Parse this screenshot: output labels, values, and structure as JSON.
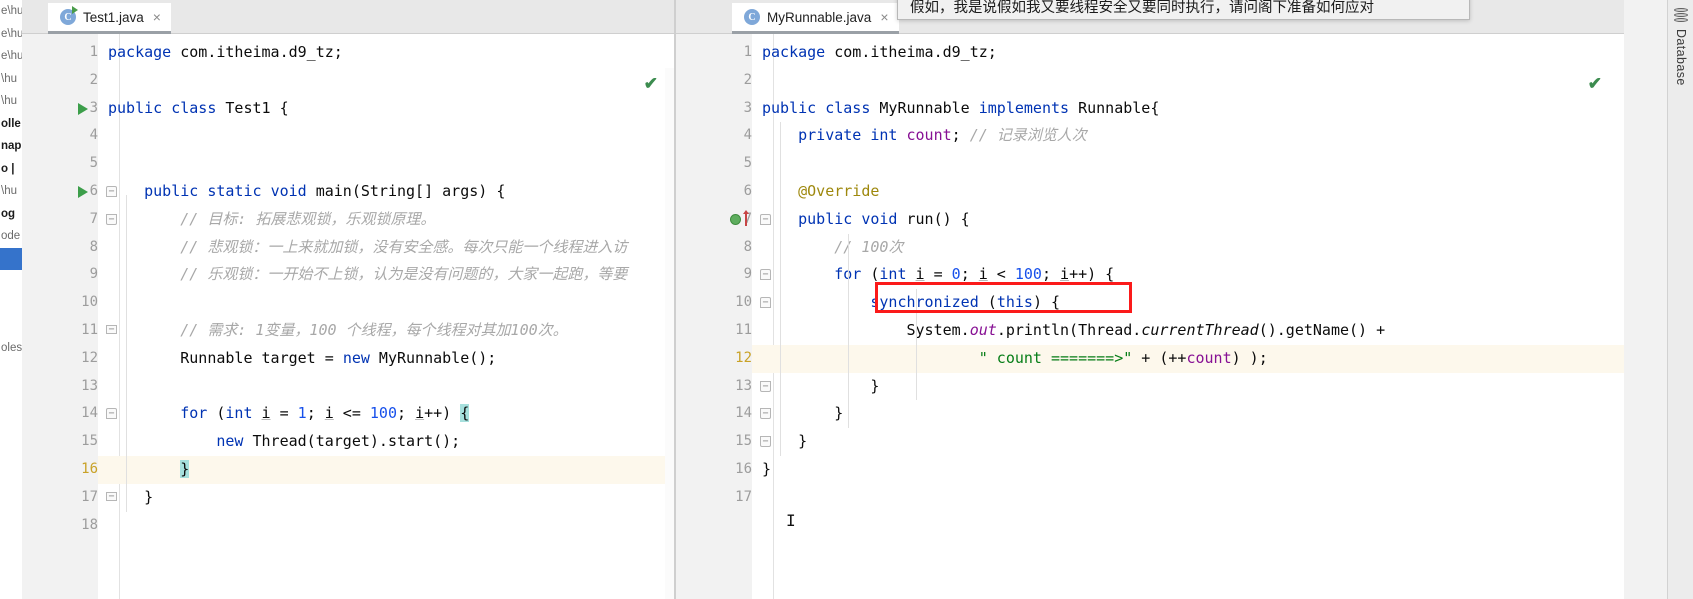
{
  "window": {
    "right_tool_tab": "Database",
    "right_tool_icon": "database-icon"
  },
  "popup": {
    "text": "假如，我是说假如我又要线程安全又要同时执行，请问阁下准备如何应对"
  },
  "background_panel": {
    "lines": [
      "e\\hu",
      "e\\hu",
      "e\\hu",
      "\\hu",
      "\\hu",
      "olle",
      "nap",
      "o |",
      "\\hu",
      "og",
      "ode",
      "",
      "",
      "oles"
    ]
  },
  "panes": [
    {
      "id": "left",
      "tab": {
        "label": "Test1.java",
        "icon": "java-class-icon",
        "close": "×",
        "has_run_marker": true
      },
      "status_check": "✔",
      "lines": [
        {
          "n": 1,
          "gutter": {
            "run": false,
            "fold": null
          },
          "tokens": [
            {
              "t": "package",
              "c": "kw"
            },
            {
              "t": " com.itheima.d9_tz;",
              "c": ""
            }
          ]
        },
        {
          "n": 2,
          "gutter": {},
          "tokens": []
        },
        {
          "n": 3,
          "gutter": {
            "run": true
          },
          "tokens": [
            {
              "t": "public",
              "c": "kw"
            },
            {
              "t": " ",
              "c": ""
            },
            {
              "t": "class",
              "c": "kw"
            },
            {
              "t": " Test1 {",
              "c": ""
            }
          ]
        },
        {
          "n": 4,
          "gutter": {},
          "tokens": []
        },
        {
          "n": 5,
          "gutter": {},
          "tokens": []
        },
        {
          "n": 6,
          "gutter": {
            "run": true,
            "fold": "top"
          },
          "tokens": [
            {
              "t": "    ",
              "c": ""
            },
            {
              "t": "public",
              "c": "kw"
            },
            {
              "t": " ",
              "c": ""
            },
            {
              "t": "static",
              "c": "kw"
            },
            {
              "t": " ",
              "c": ""
            },
            {
              "t": "void",
              "c": "kw"
            },
            {
              "t": " main(String[] args) {",
              "c": ""
            }
          ]
        },
        {
          "n": 7,
          "gutter": {
            "fold": "bot"
          },
          "tokens": [
            {
              "t": "        // 目标: 拓展悲观锁，乐观锁原理。",
              "c": "cmt"
            }
          ]
        },
        {
          "n": 8,
          "gutter": {},
          "tokens": [
            {
              "t": "        // 悲观锁：一上来就加锁，没有安全感。每次只能一个线程进入访",
              "c": "cmt"
            }
          ]
        },
        {
          "n": 9,
          "gutter": {},
          "tokens": [
            {
              "t": "        // 乐观锁：一开始不上锁，认为是没有问题的，大家一起跑，等要",
              "c": "cmt"
            }
          ]
        },
        {
          "n": 10,
          "gutter": {},
          "tokens": []
        },
        {
          "n": 11,
          "gutter": {
            "fold": "mid"
          },
          "tokens": [
            {
              "t": "        // 需求: 1变量，100 个线程，每个线程对其加100次。",
              "c": "cmt"
            }
          ]
        },
        {
          "n": 12,
          "gutter": {},
          "tokens": [
            {
              "t": "        Runnable target = ",
              "c": ""
            },
            {
              "t": "new",
              "c": "kw"
            },
            {
              "t": " MyRunnable();",
              "c": ""
            }
          ]
        },
        {
          "n": 13,
          "gutter": {},
          "tokens": []
        },
        {
          "n": 14,
          "gutter": {
            "fold": "top"
          },
          "tokens": [
            {
              "t": "        ",
              "c": ""
            },
            {
              "t": "for",
              "c": "kw"
            },
            {
              "t": " (",
              "c": ""
            },
            {
              "t": "int",
              "c": "kw"
            },
            {
              "t": " ",
              "c": ""
            },
            {
              "t": "i",
              "c": "var"
            },
            {
              "t": " = ",
              "c": ""
            },
            {
              "t": "1",
              "c": "num"
            },
            {
              "t": "; ",
              "c": ""
            },
            {
              "t": "i",
              "c": "var"
            },
            {
              "t": " <= ",
              "c": ""
            },
            {
              "t": "100",
              "c": "num"
            },
            {
              "t": "; ",
              "c": ""
            },
            {
              "t": "i",
              "c": "var"
            },
            {
              "t": "++) ",
              "c": ""
            },
            {
              "t": "{",
              "c": "sel"
            }
          ]
        },
        {
          "n": 15,
          "gutter": {},
          "tokens": [
            {
              "t": "            ",
              "c": ""
            },
            {
              "t": "new",
              "c": "kw"
            },
            {
              "t": " Thread(target).start();",
              "c": ""
            }
          ]
        },
        {
          "n": 16,
          "gutter": {
            "fold": "mid"
          },
          "highlight": true,
          "tokens": [
            {
              "t": "        ",
              "c": ""
            },
            {
              "t": "}",
              "c": "sel"
            }
          ]
        },
        {
          "n": 17,
          "gutter": {
            "fold": "mid"
          },
          "tokens": [
            {
              "t": "    }",
              "c": ""
            }
          ]
        },
        {
          "n": 18,
          "gutter": {},
          "tokens": []
        }
      ]
    },
    {
      "id": "right",
      "tab": {
        "label": "MyRunnable.java",
        "icon": "java-class-icon",
        "close": "×",
        "has_run_marker": false
      },
      "status_check": "✔",
      "lines": [
        {
          "n": 1,
          "gutter": {},
          "tokens": [
            {
              "t": "package",
              "c": "kw"
            },
            {
              "t": " com.itheima.d9_tz;",
              "c": ""
            }
          ]
        },
        {
          "n": 2,
          "gutter": {},
          "tokens": []
        },
        {
          "n": 3,
          "gutter": {},
          "tokens": [
            {
              "t": "public",
              "c": "kw"
            },
            {
              "t": " ",
              "c": ""
            },
            {
              "t": "class",
              "c": "kw"
            },
            {
              "t": " MyRunnable ",
              "c": ""
            },
            {
              "t": "implements",
              "c": "kw"
            },
            {
              "t": " Runnable{",
              "c": ""
            }
          ]
        },
        {
          "n": 4,
          "gutter": {},
          "tokens": [
            {
              "t": "    ",
              "c": ""
            },
            {
              "t": "private",
              "c": "kw"
            },
            {
              "t": " ",
              "c": ""
            },
            {
              "t": "int",
              "c": "kw"
            },
            {
              "t": " ",
              "c": ""
            },
            {
              "t": "count",
              "c": "fld"
            },
            {
              "t": "; ",
              "c": ""
            },
            {
              "t": "// 记录浏览人次",
              "c": "cmt"
            }
          ]
        },
        {
          "n": 5,
          "gutter": {},
          "tokens": []
        },
        {
          "n": 6,
          "gutter": {},
          "tokens": [
            {
              "t": "    ",
              "c": ""
            },
            {
              "t": "@Override",
              "c": "anno"
            }
          ]
        },
        {
          "n": 7,
          "gutter": {
            "breakpoint": true,
            "fold": "top"
          },
          "tokens": [
            {
              "t": "    ",
              "c": ""
            },
            {
              "t": "public",
              "c": "kw"
            },
            {
              "t": " ",
              "c": ""
            },
            {
              "t": "void",
              "c": "kw"
            },
            {
              "t": " run() {",
              "c": ""
            }
          ]
        },
        {
          "n": 8,
          "gutter": {},
          "tokens": [
            {
              "t": "        // 100次",
              "c": "cmt"
            }
          ]
        },
        {
          "n": 9,
          "gutter": {
            "fold": "top"
          },
          "tokens": [
            {
              "t": "        ",
              "c": ""
            },
            {
              "t": "for",
              "c": "kw"
            },
            {
              "t": " (",
              "c": ""
            },
            {
              "t": "int",
              "c": "kw"
            },
            {
              "t": " ",
              "c": ""
            },
            {
              "t": "i",
              "c": "var"
            },
            {
              "t": " = ",
              "c": ""
            },
            {
              "t": "0",
              "c": "num"
            },
            {
              "t": "; ",
              "c": ""
            },
            {
              "t": "i",
              "c": "var"
            },
            {
              "t": " < ",
              "c": ""
            },
            {
              "t": "100",
              "c": "num"
            },
            {
              "t": "; ",
              "c": ""
            },
            {
              "t": "i",
              "c": "var"
            },
            {
              "t": "++) {",
              "c": ""
            }
          ]
        },
        {
          "n": 10,
          "gutter": {
            "fold": "top"
          },
          "tokens": [
            {
              "t": "            ",
              "c": ""
            },
            {
              "t": "synchronized",
              "c": "kw"
            },
            {
              "t": " (",
              "c": ""
            },
            {
              "t": "this",
              "c": "kw"
            },
            {
              "t": ") {",
              "c": ""
            }
          ]
        },
        {
          "n": 11,
          "gutter": {},
          "tokens": [
            {
              "t": "                System.",
              "c": ""
            },
            {
              "t": "out",
              "c": "fld ital"
            },
            {
              "t": ".println(Thread.",
              "c": ""
            },
            {
              "t": "currentThread",
              "c": "ital"
            },
            {
              "t": "().getName() +",
              "c": ""
            }
          ]
        },
        {
          "n": 12,
          "gutter": {},
          "highlight": true,
          "tokens": [
            {
              "t": "                        ",
              "c": ""
            },
            {
              "t": "\" count =======>\"",
              "c": "str"
            },
            {
              "t": " + (++",
              "c": ""
            },
            {
              "t": "count",
              "c": "fld"
            },
            {
              "t": ") );",
              "c": ""
            }
          ]
        },
        {
          "n": 13,
          "gutter": {
            "fold": "bot"
          },
          "tokens": [
            {
              "t": "            }",
              "c": ""
            }
          ]
        },
        {
          "n": 14,
          "gutter": {
            "fold": "bot"
          },
          "tokens": [
            {
              "t": "        }",
              "c": ""
            }
          ]
        },
        {
          "n": 15,
          "gutter": {
            "fold": "bot"
          },
          "tokens": [
            {
              "t": "    }",
              "c": ""
            }
          ]
        },
        {
          "n": 16,
          "gutter": {},
          "tokens": [
            {
              "t": "}",
              "c": ""
            }
          ]
        },
        {
          "n": 17,
          "gutter": {},
          "tokens": []
        }
      ]
    }
  ],
  "annotation": {
    "red_box_target": "synchronized (this) {",
    "color": "#fb1a1a"
  }
}
